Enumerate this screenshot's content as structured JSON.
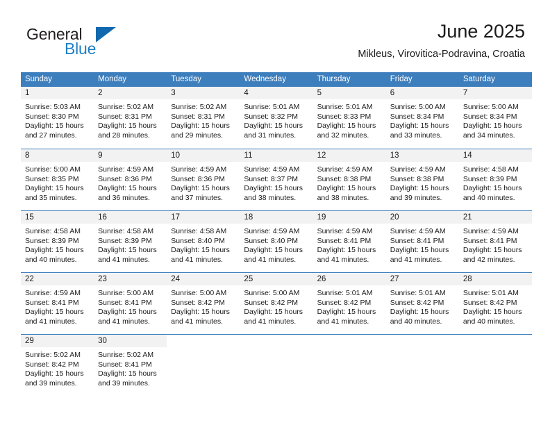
{
  "brand": {
    "line1": "General",
    "line2": "Blue",
    "flag_color": "#1268ae",
    "accent_color": "#1e7fc4"
  },
  "header": {
    "title": "June 2025",
    "subtitle": "Mikleus, Virovitica-Podravina, Croatia"
  },
  "theme": {
    "header_blue": "#3d7ebd",
    "daynum_band": "#f2f2f2",
    "text": "#1a1a1a"
  },
  "weekdays": [
    "Sunday",
    "Monday",
    "Tuesday",
    "Wednesday",
    "Thursday",
    "Friday",
    "Saturday"
  ],
  "weeks": [
    [
      {
        "day": "1",
        "sunrise": "Sunrise: 5:03 AM",
        "sunset": "Sunset: 8:30 PM",
        "daylight_1": "Daylight: 15 hours",
        "daylight_2": "and 27 minutes."
      },
      {
        "day": "2",
        "sunrise": "Sunrise: 5:02 AM",
        "sunset": "Sunset: 8:31 PM",
        "daylight_1": "Daylight: 15 hours",
        "daylight_2": "and 28 minutes."
      },
      {
        "day": "3",
        "sunrise": "Sunrise: 5:02 AM",
        "sunset": "Sunset: 8:31 PM",
        "daylight_1": "Daylight: 15 hours",
        "daylight_2": "and 29 minutes."
      },
      {
        "day": "4",
        "sunrise": "Sunrise: 5:01 AM",
        "sunset": "Sunset: 8:32 PM",
        "daylight_1": "Daylight: 15 hours",
        "daylight_2": "and 31 minutes."
      },
      {
        "day": "5",
        "sunrise": "Sunrise: 5:01 AM",
        "sunset": "Sunset: 8:33 PM",
        "daylight_1": "Daylight: 15 hours",
        "daylight_2": "and 32 minutes."
      },
      {
        "day": "6",
        "sunrise": "Sunrise: 5:00 AM",
        "sunset": "Sunset: 8:34 PM",
        "daylight_1": "Daylight: 15 hours",
        "daylight_2": "and 33 minutes."
      },
      {
        "day": "7",
        "sunrise": "Sunrise: 5:00 AM",
        "sunset": "Sunset: 8:34 PM",
        "daylight_1": "Daylight: 15 hours",
        "daylight_2": "and 34 minutes."
      }
    ],
    [
      {
        "day": "8",
        "sunrise": "Sunrise: 5:00 AM",
        "sunset": "Sunset: 8:35 PM",
        "daylight_1": "Daylight: 15 hours",
        "daylight_2": "and 35 minutes."
      },
      {
        "day": "9",
        "sunrise": "Sunrise: 4:59 AM",
        "sunset": "Sunset: 8:36 PM",
        "daylight_1": "Daylight: 15 hours",
        "daylight_2": "and 36 minutes."
      },
      {
        "day": "10",
        "sunrise": "Sunrise: 4:59 AM",
        "sunset": "Sunset: 8:36 PM",
        "daylight_1": "Daylight: 15 hours",
        "daylight_2": "and 37 minutes."
      },
      {
        "day": "11",
        "sunrise": "Sunrise: 4:59 AM",
        "sunset": "Sunset: 8:37 PM",
        "daylight_1": "Daylight: 15 hours",
        "daylight_2": "and 38 minutes."
      },
      {
        "day": "12",
        "sunrise": "Sunrise: 4:59 AM",
        "sunset": "Sunset: 8:38 PM",
        "daylight_1": "Daylight: 15 hours",
        "daylight_2": "and 38 minutes."
      },
      {
        "day": "13",
        "sunrise": "Sunrise: 4:59 AM",
        "sunset": "Sunset: 8:38 PM",
        "daylight_1": "Daylight: 15 hours",
        "daylight_2": "and 39 minutes."
      },
      {
        "day": "14",
        "sunrise": "Sunrise: 4:58 AM",
        "sunset": "Sunset: 8:39 PM",
        "daylight_1": "Daylight: 15 hours",
        "daylight_2": "and 40 minutes."
      }
    ],
    [
      {
        "day": "15",
        "sunrise": "Sunrise: 4:58 AM",
        "sunset": "Sunset: 8:39 PM",
        "daylight_1": "Daylight: 15 hours",
        "daylight_2": "and 40 minutes."
      },
      {
        "day": "16",
        "sunrise": "Sunrise: 4:58 AM",
        "sunset": "Sunset: 8:39 PM",
        "daylight_1": "Daylight: 15 hours",
        "daylight_2": "and 41 minutes."
      },
      {
        "day": "17",
        "sunrise": "Sunrise: 4:58 AM",
        "sunset": "Sunset: 8:40 PM",
        "daylight_1": "Daylight: 15 hours",
        "daylight_2": "and 41 minutes."
      },
      {
        "day": "18",
        "sunrise": "Sunrise: 4:59 AM",
        "sunset": "Sunset: 8:40 PM",
        "daylight_1": "Daylight: 15 hours",
        "daylight_2": "and 41 minutes."
      },
      {
        "day": "19",
        "sunrise": "Sunrise: 4:59 AM",
        "sunset": "Sunset: 8:41 PM",
        "daylight_1": "Daylight: 15 hours",
        "daylight_2": "and 41 minutes."
      },
      {
        "day": "20",
        "sunrise": "Sunrise: 4:59 AM",
        "sunset": "Sunset: 8:41 PM",
        "daylight_1": "Daylight: 15 hours",
        "daylight_2": "and 41 minutes."
      },
      {
        "day": "21",
        "sunrise": "Sunrise: 4:59 AM",
        "sunset": "Sunset: 8:41 PM",
        "daylight_1": "Daylight: 15 hours",
        "daylight_2": "and 42 minutes."
      }
    ],
    [
      {
        "day": "22",
        "sunrise": "Sunrise: 4:59 AM",
        "sunset": "Sunset: 8:41 PM",
        "daylight_1": "Daylight: 15 hours",
        "daylight_2": "and 41 minutes."
      },
      {
        "day": "23",
        "sunrise": "Sunrise: 5:00 AM",
        "sunset": "Sunset: 8:41 PM",
        "daylight_1": "Daylight: 15 hours",
        "daylight_2": "and 41 minutes."
      },
      {
        "day": "24",
        "sunrise": "Sunrise: 5:00 AM",
        "sunset": "Sunset: 8:42 PM",
        "daylight_1": "Daylight: 15 hours",
        "daylight_2": "and 41 minutes."
      },
      {
        "day": "25",
        "sunrise": "Sunrise: 5:00 AM",
        "sunset": "Sunset: 8:42 PM",
        "daylight_1": "Daylight: 15 hours",
        "daylight_2": "and 41 minutes."
      },
      {
        "day": "26",
        "sunrise": "Sunrise: 5:01 AM",
        "sunset": "Sunset: 8:42 PM",
        "daylight_1": "Daylight: 15 hours",
        "daylight_2": "and 41 minutes."
      },
      {
        "day": "27",
        "sunrise": "Sunrise: 5:01 AM",
        "sunset": "Sunset: 8:42 PM",
        "daylight_1": "Daylight: 15 hours",
        "daylight_2": "and 40 minutes."
      },
      {
        "day": "28",
        "sunrise": "Sunrise: 5:01 AM",
        "sunset": "Sunset: 8:42 PM",
        "daylight_1": "Daylight: 15 hours",
        "daylight_2": "and 40 minutes."
      }
    ],
    [
      {
        "day": "29",
        "sunrise": "Sunrise: 5:02 AM",
        "sunset": "Sunset: 8:42 PM",
        "daylight_1": "Daylight: 15 hours",
        "daylight_2": "and 39 minutes."
      },
      {
        "day": "30",
        "sunrise": "Sunrise: 5:02 AM",
        "sunset": "Sunset: 8:41 PM",
        "daylight_1": "Daylight: 15 hours",
        "daylight_2": "and 39 minutes."
      },
      {
        "day": "",
        "sunrise": "",
        "sunset": "",
        "daylight_1": "",
        "daylight_2": ""
      },
      {
        "day": "",
        "sunrise": "",
        "sunset": "",
        "daylight_1": "",
        "daylight_2": ""
      },
      {
        "day": "",
        "sunrise": "",
        "sunset": "",
        "daylight_1": "",
        "daylight_2": ""
      },
      {
        "day": "",
        "sunrise": "",
        "sunset": "",
        "daylight_1": "",
        "daylight_2": ""
      },
      {
        "day": "",
        "sunrise": "",
        "sunset": "",
        "daylight_1": "",
        "daylight_2": ""
      }
    ]
  ]
}
